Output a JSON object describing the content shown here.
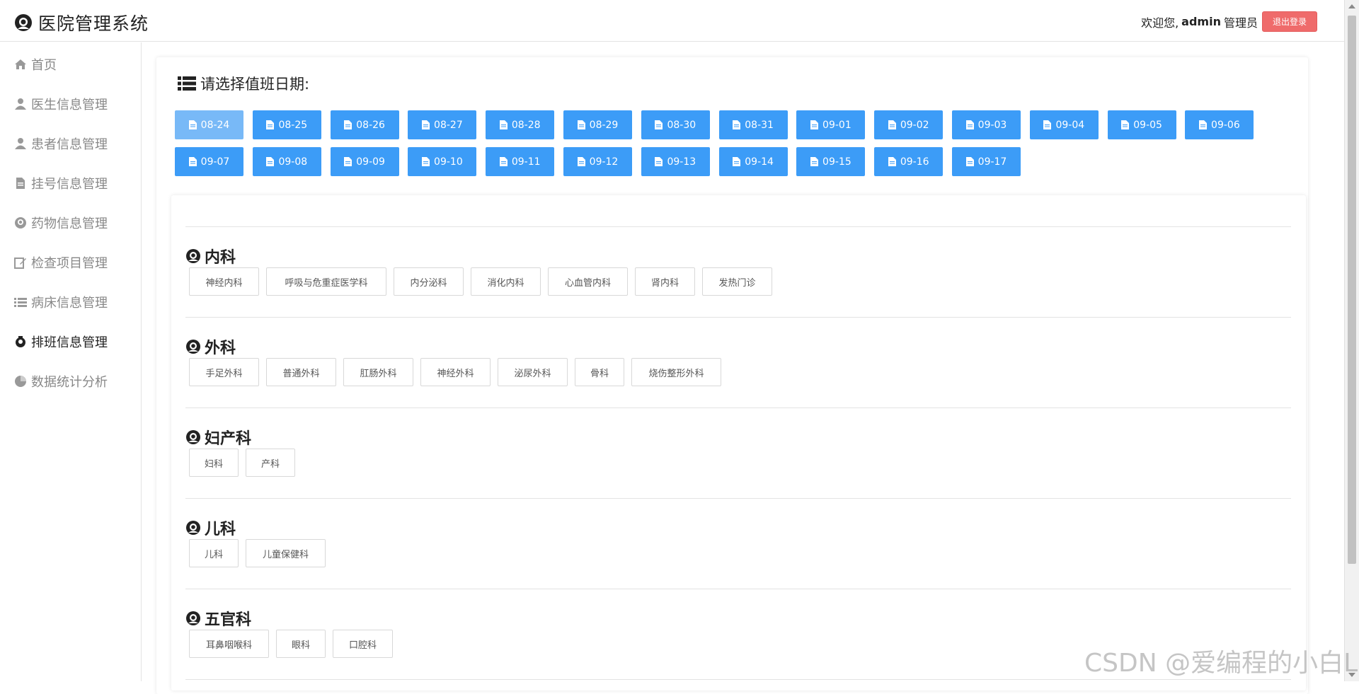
{
  "header": {
    "app_title": "医院管理系统",
    "welcome": "欢迎您,",
    "username": "admin",
    "role": "管理员",
    "logout_label": "退出登录"
  },
  "sidebar": {
    "items": [
      {
        "label": "首页",
        "icon": "home-icon"
      },
      {
        "label": "医生信息管理",
        "icon": "user-icon"
      },
      {
        "label": "患者信息管理",
        "icon": "user-icon"
      },
      {
        "label": "挂号信息管理",
        "icon": "file-icon"
      },
      {
        "label": "药物信息管理",
        "icon": "doctor-icon"
      },
      {
        "label": "检查项目管理",
        "icon": "edit-icon"
      },
      {
        "label": "病床信息管理",
        "icon": "list-icon"
      },
      {
        "label": "排班信息管理",
        "icon": "badge-icon"
      },
      {
        "label": "数据统计分析",
        "icon": "chart-icon"
      }
    ],
    "active_index": 7
  },
  "schedule": {
    "title": "请选择值班日期:",
    "dates": [
      "08-24",
      "08-25",
      "08-26",
      "08-27",
      "08-28",
      "08-29",
      "08-30",
      "08-31",
      "09-01",
      "09-02",
      "09-03",
      "09-04",
      "09-05",
      "09-06",
      "09-07",
      "09-08",
      "09-09",
      "09-10",
      "09-11",
      "09-12",
      "09-13",
      "09-14",
      "09-15",
      "09-16",
      "09-17"
    ],
    "active_date_index": 0
  },
  "departments": [
    {
      "name": "内科",
      "subs": [
        "神经内科",
        "呼吸与危重症医学科",
        "内分泌科",
        "消化内科",
        "心血管内科",
        "肾内科",
        "发热门诊"
      ]
    },
    {
      "name": "外科",
      "subs": [
        "手足外科",
        "普通外科",
        "肛肠外科",
        "神经外科",
        "泌尿外科",
        "骨科",
        "烧伤整形外科"
      ]
    },
    {
      "name": "妇产科",
      "subs": [
        "妇科",
        "产科"
      ]
    },
    {
      "name": "儿科",
      "subs": [
        "儿科",
        "儿童保健科"
      ]
    },
    {
      "name": "五官科",
      "subs": [
        "耳鼻咽喉科",
        "眼科",
        "口腔科"
      ]
    }
  ],
  "watermark": "CSDN @爱编程的小白L",
  "colors": {
    "primary": "#3c9cf7",
    "primary_active": "#78b9f7",
    "logout": "#ef6b6b"
  }
}
